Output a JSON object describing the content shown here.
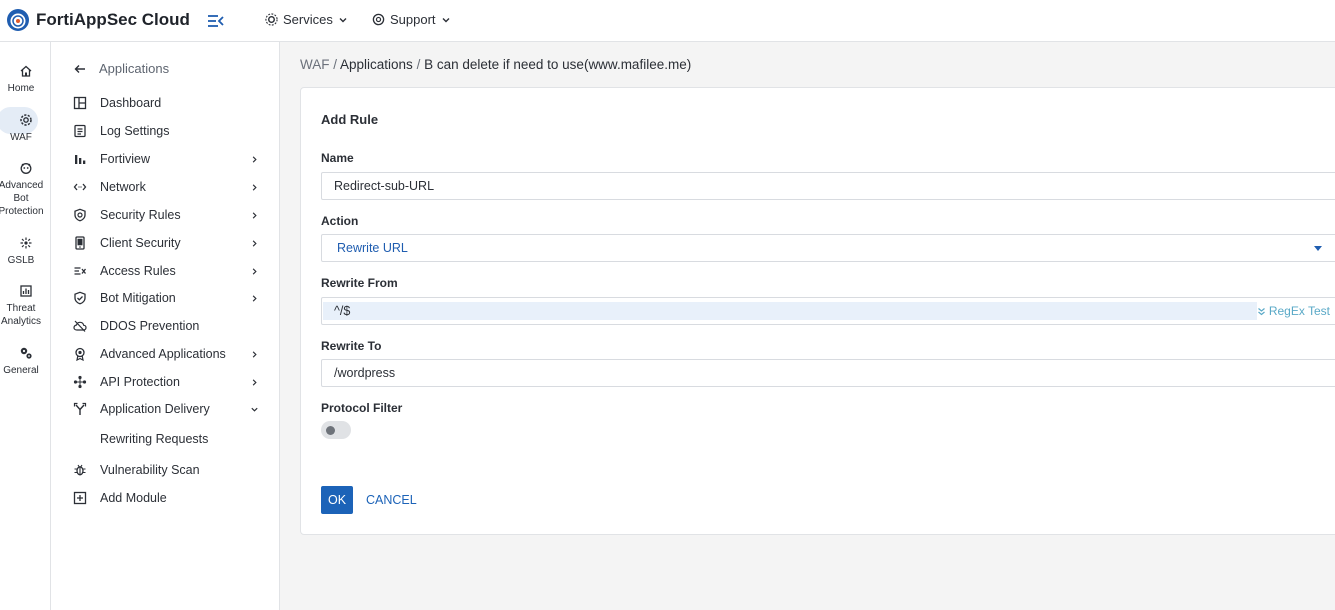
{
  "app": {
    "title": "FortiAppSec Cloud"
  },
  "topnav": {
    "services": "Services",
    "support": "Support"
  },
  "rail": [
    {
      "label": "Home",
      "icon": "home-icon"
    },
    {
      "label": "WAF",
      "icon": "gear-icon",
      "active": true
    },
    {
      "label": "Advanced",
      "icon": "bot-icon"
    },
    {
      "label": "Bot",
      "icon": ""
    },
    {
      "label": "Protection",
      "icon": ""
    },
    {
      "label": "GSLB",
      "icon": "globe-icon"
    },
    {
      "label": "Threat",
      "icon": "chart-icon"
    },
    {
      "label": "Analytics",
      "icon": ""
    },
    {
      "label": "General",
      "icon": "gears-icon"
    }
  ],
  "subnav": {
    "back_label": "Applications",
    "items": [
      {
        "label": "Dashboard",
        "icon": "dashboard-icon"
      },
      {
        "label": "Log Settings",
        "icon": "document-icon"
      },
      {
        "label": "Fortiview",
        "icon": "bar-chart-icon",
        "chevron": "right"
      },
      {
        "label": "Network",
        "icon": "code-arrows-icon",
        "chevron": "right"
      },
      {
        "label": "Security Rules",
        "icon": "shield-icon",
        "chevron": "right"
      },
      {
        "label": "Client Security",
        "icon": "phone-icon",
        "chevron": "right"
      },
      {
        "label": "Access Rules",
        "icon": "filter-x-icon",
        "chevron": "right"
      },
      {
        "label": "Bot Mitigation",
        "icon": "shield-check-icon",
        "chevron": "right"
      },
      {
        "label": "DDOS Prevention",
        "icon": "cloud-slash-icon"
      },
      {
        "label": "Advanced Applications",
        "icon": "award-icon",
        "chevron": "right"
      },
      {
        "label": "API Protection",
        "icon": "api-icon",
        "chevron": "right"
      },
      {
        "label": "Application Delivery",
        "icon": "fork-icon",
        "chevron": "down"
      },
      {
        "label": "Rewriting Requests",
        "icon": ""
      },
      {
        "label": "Vulnerability Scan",
        "icon": "bug-icon"
      },
      {
        "label": "Add Module",
        "icon": "plus-square-icon"
      }
    ]
  },
  "breadcrumb": {
    "root": "WAF",
    "sep": " / ",
    "apps": "Applications",
    "current": "B can delete if need to use(www.mafilee.me)"
  },
  "form": {
    "title": "Add Rule",
    "name_label": "Name",
    "name_value": "Redirect-sub-URL",
    "action_label": "Action",
    "action_value": "Rewrite URL",
    "rewrite_from_label": "Rewrite From",
    "rewrite_from_value": "^/$",
    "regex_test": "RegEx Test",
    "rewrite_to_label": "Rewrite To",
    "rewrite_to_value": "/wordpress",
    "protocol_filter_label": "Protocol Filter",
    "protocol_filter_on": false,
    "ok": "OK",
    "cancel": "CANCEL"
  },
  "colors": {
    "accent": "#1c63b8",
    "regex": "#5aa9c7",
    "active_pill": "#e4ecf6"
  }
}
